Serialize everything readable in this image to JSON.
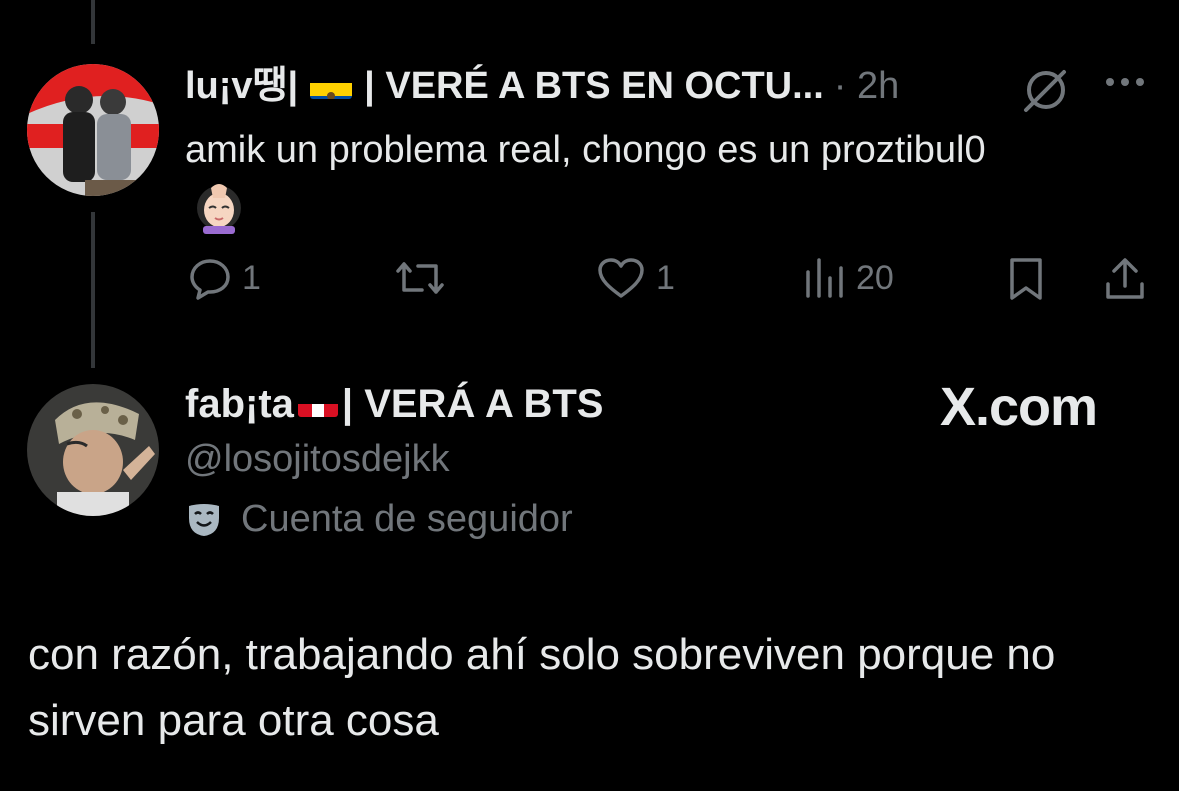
{
  "tweet": {
    "display_name": "lu¡v땡|",
    "name_suffix": "| VERÉ A BTS EN OCTU...",
    "time": "· 2h",
    "text": "amik un problema real, chongo es un proztibul0",
    "actions": {
      "replies": "1",
      "retweets": "",
      "likes": "1",
      "views": "20"
    },
    "icons": [
      "grok-icon",
      "more-icon",
      "reply-icon",
      "retweet-icon",
      "like-icon",
      "views-icon",
      "bookmark-icon",
      "share-icon"
    ]
  },
  "quoted_profile": {
    "display_name": "fab¡ta",
    "name_suffix": "| VERÁ A BTS",
    "handle": "@losojitosdejkk",
    "follower_label": "Cuenta de seguidor",
    "watermark": "X.com"
  },
  "reply": {
    "text": "con razón, trabajando ahí solo sobreviven porque no sirven para otra cosa"
  },
  "colors": {
    "background": "#000000",
    "text": "#e7e9ea",
    "secondary": "#71767b",
    "thread_line": "#333639"
  }
}
